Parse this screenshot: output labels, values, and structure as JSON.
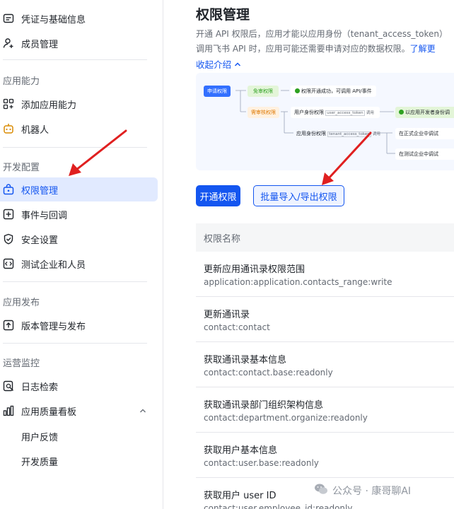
{
  "sidebar": {
    "items_top": [
      {
        "label": "凭证与基础信息",
        "icon": "credential-icon"
      },
      {
        "label": "成员管理",
        "icon": "user-add-icon"
      }
    ],
    "section_capability": "应用能力",
    "items_capability": [
      {
        "label": "添加应用能力",
        "icon": "grid-plus-icon"
      },
      {
        "label": "机器人",
        "icon": "robot-icon"
      }
    ],
    "section_dev": "开发配置",
    "items_dev": [
      {
        "label": "权限管理",
        "icon": "permission-icon",
        "active": true
      },
      {
        "label": "事件与回调",
        "icon": "event-icon"
      },
      {
        "label": "安全设置",
        "icon": "shield-icon"
      },
      {
        "label": "测试企业和人员",
        "icon": "code-icon"
      }
    ],
    "section_release": "应用发布",
    "items_release": [
      {
        "label": "版本管理与发布",
        "icon": "upload-icon"
      }
    ],
    "section_monitor": "运营监控",
    "items_monitor": [
      {
        "label": "日志检索",
        "icon": "log-search-icon"
      },
      {
        "label": "应用质量看板",
        "icon": "bar-chart-icon"
      }
    ],
    "sub_items": [
      "用户反馈",
      "开发质量"
    ]
  },
  "main": {
    "title": "权限管理",
    "desc_line1": "开通 API 权限后，应用才能以应用身份（tenant_access_token）",
    "desc_line2": "调用飞书 API 时，应用可能还需要申请对应的数据权限。",
    "desc_link": "了解更",
    "collapse": "收起介绍",
    "diagram": {
      "apply": "申请权限",
      "free": "免审权限",
      "success": "权限开通成功，可调用 API/事件",
      "review": "需审核权限",
      "user_perm": "用户身份权限",
      "user_token": "user_access_token",
      "call1": "调用",
      "dev_auth": "以应用开发者身份调",
      "app_perm": "应用身份权限",
      "tenant_token": "tenant_access_token",
      "call2": "调用",
      "formal": "在正式企业中调试",
      "test": "在测试企业中调试"
    },
    "btn_open": "开通权限",
    "btn_batch": "批量导入/导出权限",
    "table_header": "权限名称",
    "rows": [
      {
        "name": "更新应用通讯录权限范围",
        "code": "application:application.contacts_range:write"
      },
      {
        "name": "更新通讯录",
        "code": "contact:contact"
      },
      {
        "name": "获取通讯录基本信息",
        "code": "contact:contact.base:readonly"
      },
      {
        "name": "获取通讯录部门组织架构信息",
        "code": "contact:department.organize:readonly"
      },
      {
        "name": "获取用户基本信息",
        "code": "contact:user.base:readonly"
      },
      {
        "name": "获取用户 user ID",
        "code": "contact:user.employee_id:readonly"
      }
    ]
  },
  "watermark": "公众号 · 康哥聊AI",
  "colors": {
    "accent": "#1456f0",
    "active_bg": "#e1eaff",
    "arrow": "#e02020",
    "green": "#2ea121"
  }
}
